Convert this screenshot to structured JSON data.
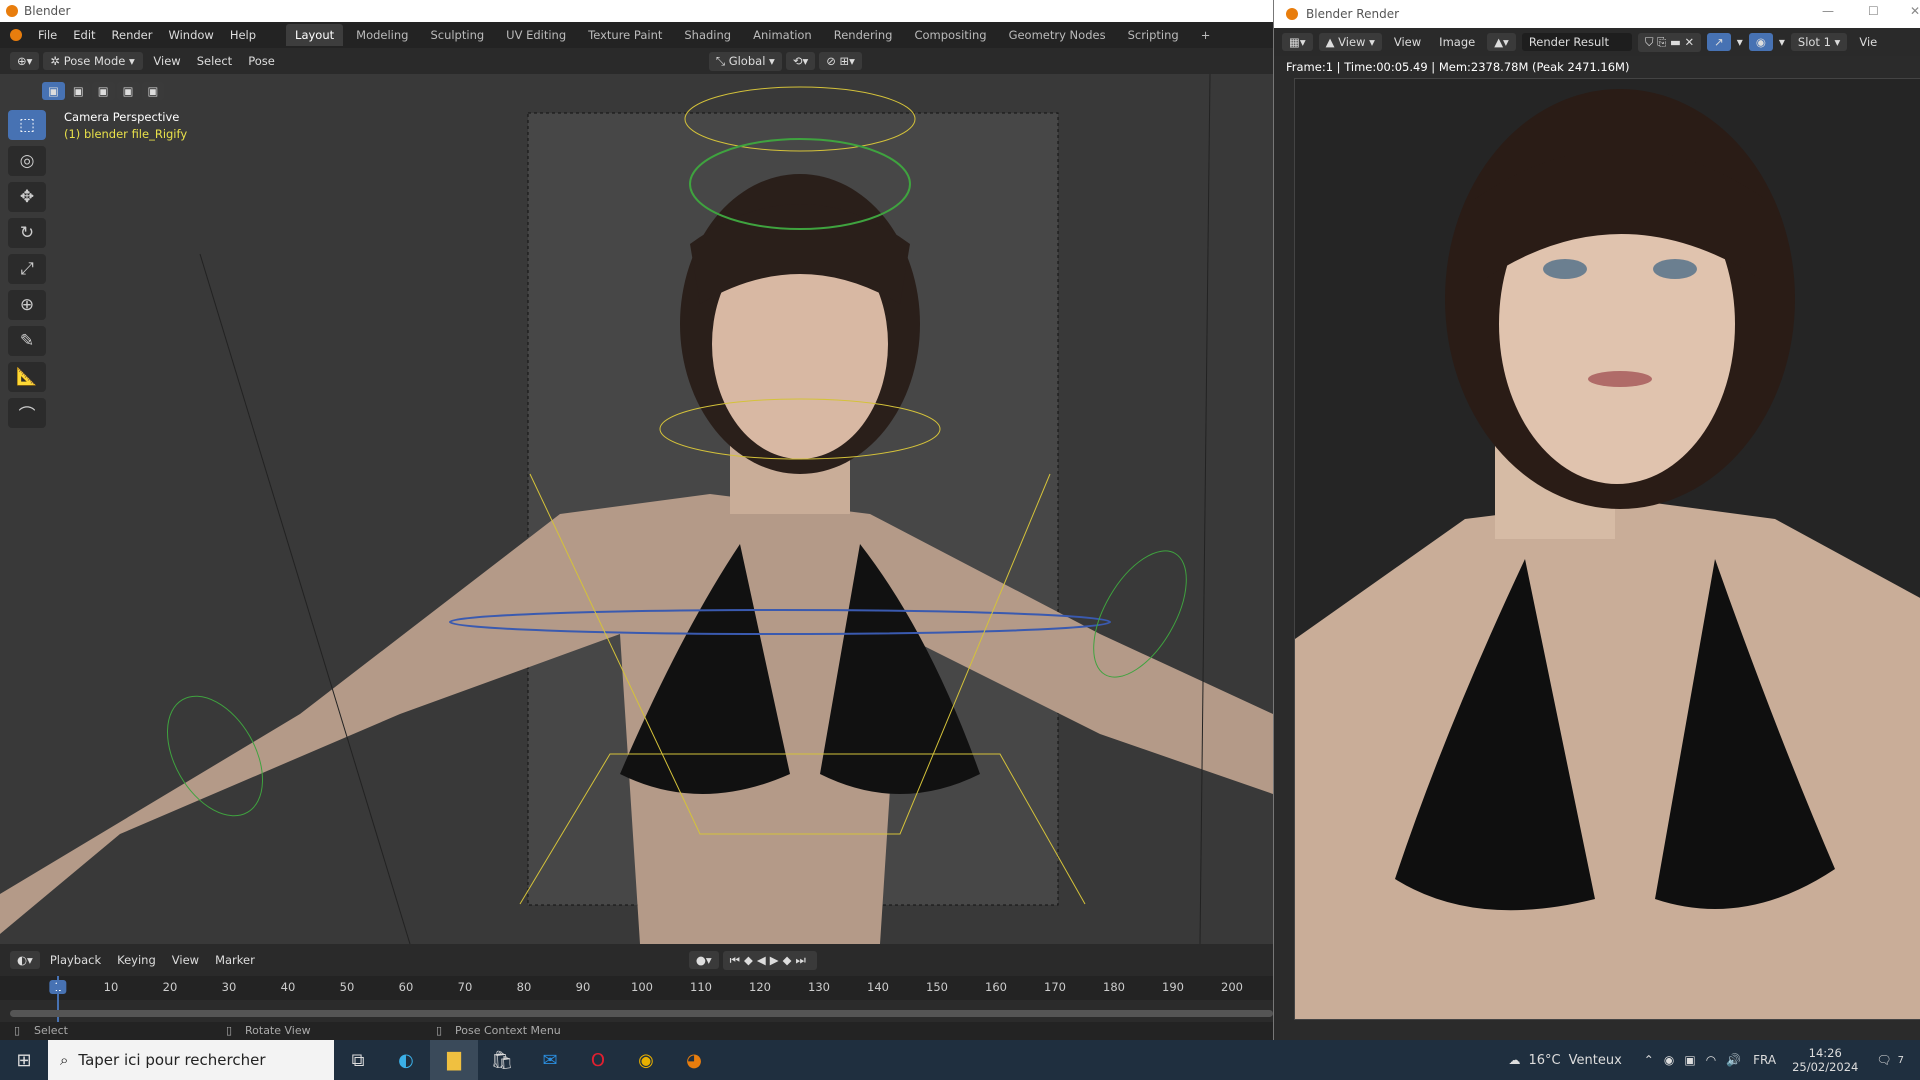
{
  "blender": {
    "title": "Blender",
    "menu": [
      "File",
      "Edit",
      "Render",
      "Window",
      "Help"
    ],
    "workspaces": [
      "Layout",
      "Modeling",
      "Sculpting",
      "UV Editing",
      "Texture Paint",
      "Shading",
      "Animation",
      "Rendering",
      "Compositing",
      "Geometry Nodes",
      "Scripting",
      "+"
    ],
    "active_workspace": "Layout",
    "header": {
      "mode": "Pose Mode",
      "menus": [
        "View",
        "Select",
        "Pose"
      ],
      "orientation": "Global"
    },
    "viewport": {
      "view_name": "Camera Perspective",
      "object_name": "(1) blender file_Rigify"
    },
    "timeline": {
      "menus": [
        "Playback",
        "Keying",
        "View",
        "Marker"
      ],
      "current_frame": "1",
      "ticks": [
        "10",
        "20",
        "30",
        "40",
        "50",
        "60",
        "70",
        "80",
        "90",
        "100",
        "110",
        "120",
        "130",
        "140",
        "150",
        "160",
        "170",
        "180",
        "190",
        "200"
      ]
    },
    "status": {
      "select": "Select",
      "rotate": "Rotate View",
      "context": "Pose Context Menu"
    }
  },
  "render": {
    "title": "Blender Render",
    "view_label": "View",
    "menus": [
      "View",
      "Image"
    ],
    "image_name": "Render Result",
    "slot": "Slot 1",
    "view_cut": "Vie",
    "info": "Frame:1 | Time:00:05.49 | Mem:2378.78M (Peak 2471.16M)"
  },
  "taskbar": {
    "search_placeholder": "Taper ici pour rechercher",
    "weather": "16°C",
    "weather_desc": "Venteux",
    "lang": "FRA",
    "time": "14:26",
    "date": "25/02/2024",
    "notifications": "7"
  },
  "colors": {
    "accent": "#4772b3",
    "rig_yellow": "#d4c23a",
    "rig_green": "#3fa33f",
    "skin": "#c9a88e"
  }
}
